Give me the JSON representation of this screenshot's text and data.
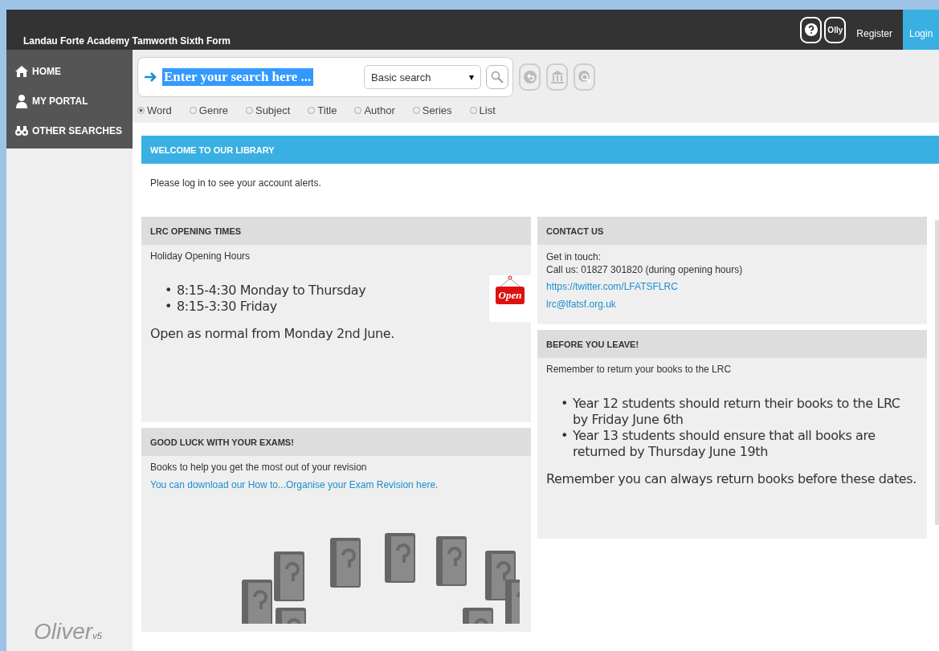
{
  "header": {
    "title": "Landau Forte Academy Tamworth Sixth Form",
    "olly": "Olly",
    "register": "Register",
    "login": "Login"
  },
  "sidebar": {
    "items": [
      {
        "label": "HOME",
        "kind": "home"
      },
      {
        "label": "MY PORTAL",
        "kind": "person"
      },
      {
        "label": "OTHER SEARCHES",
        "kind": "binoculars"
      }
    ],
    "logo": {
      "name": "Oliver",
      "version": "v5"
    }
  },
  "search": {
    "value": "Enter your search here ...",
    "mode": "Basic search",
    "mode_caret": "▾",
    "scopes": [
      {
        "label": "Word",
        "selected": true
      },
      {
        "label": "Genre",
        "selected": false
      },
      {
        "label": "Subject",
        "selected": false
      },
      {
        "label": "Title",
        "selected": false
      },
      {
        "label": "Author",
        "selected": false
      },
      {
        "label": "Series",
        "selected": false
      },
      {
        "label": "List",
        "selected": false
      }
    ]
  },
  "welcome": {
    "title": "WELCOME TO OUR LIBRARY",
    "message": "Please log in to see your account alerts."
  },
  "columns": [
    [
      {
        "title": "LRC OPENING TIMES",
        "sign": "Open",
        "blocks": [
          {
            "kind": "text",
            "text": "Holiday Opening Hours"
          },
          {
            "kind": "list",
            "bullet": "•",
            "items": [
              "8:15-4:30 Monday to Thursday",
              "8:15-3:30 Friday"
            ]
          },
          {
            "kind": "note",
            "text": "Open as normal from Monday 2nd June."
          }
        ]
      },
      {
        "title": "GOOD LUCK WITH YOUR EXAMS!",
        "blocks": [
          {
            "kind": "text",
            "text": "Books to help you get the most out of your revision"
          },
          {
            "kind": "link",
            "text": "You can download our How to...Organise your Exam Revision here."
          },
          {
            "kind": "books"
          }
        ]
      }
    ],
    [
      {
        "title": "CONTACT US",
        "blocks": [
          {
            "kind": "line",
            "text": "Get in touch:"
          },
          {
            "kind": "line",
            "text": "Call us: 01827 301820 (during opening hours)"
          },
          {
            "kind": "link",
            "text": "https://twitter.com/LFATSFLRC"
          },
          {
            "kind": "link",
            "text": "lrc@lfatsf.org.uk"
          }
        ]
      },
      {
        "title": "BEFORE YOU LEAVE!",
        "blocks": [
          {
            "kind": "text",
            "text": "Remember to return your books to the LRC"
          },
          {
            "kind": "list",
            "bullet": "•",
            "items": [
              "Year 12 students should return their books to the LRC by Friday June 6th",
              "Year 13 students should ensure that all books are returned by Thursday June 19th"
            ]
          },
          {
            "kind": "note",
            "text": "Remember you can always return books before these dates."
          }
        ]
      }
    ]
  ]
}
